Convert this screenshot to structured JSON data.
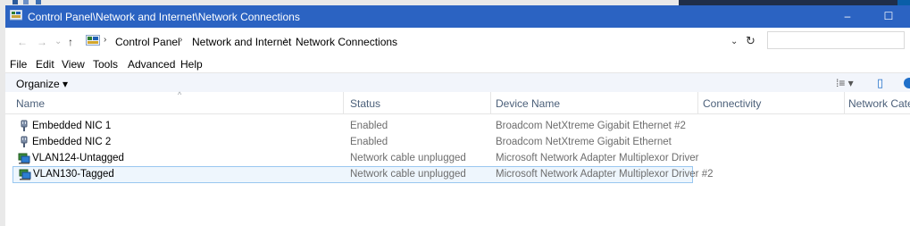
{
  "window": {
    "title": "Control Panel\\Network and Internet\\Network Connections",
    "minimize": "–",
    "maximize": "☐",
    "close": "✕"
  },
  "nav": {
    "back": "←",
    "forward": "→",
    "recent": "⌄",
    "up": "↑"
  },
  "address": {
    "crumbs": [
      "Control Panel",
      "Network and Internet",
      "Network Connections"
    ],
    "separator": "›",
    "dropdown": "⌄",
    "refresh": "↻",
    "search_placeholder": ""
  },
  "menubar": {
    "items": [
      "File",
      "Edit",
      "View",
      "Tools",
      "Advanced",
      "Help"
    ]
  },
  "command_bar": {
    "organize": "Organize ▾",
    "view_options": "⁞≡ ▾",
    "preview_pane": "▯"
  },
  "columns": [
    "Name",
    "Status",
    "Device Name",
    "Connectivity",
    "Network Catego"
  ],
  "sort_indicator": "^",
  "rows": [
    {
      "name": "Embedded NIC 1",
      "status": "Enabled",
      "device": "Broadcom NetXtreme Gigabit Ethernet #2",
      "icon": "ethernet-plug-icon",
      "selected": false
    },
    {
      "name": "Embedded NIC 2",
      "status": "Enabled",
      "device": "Broadcom NetXtreme Gigabit Ethernet",
      "icon": "ethernet-plug-icon",
      "selected": false
    },
    {
      "name": "VLAN124-Untagged",
      "status": "Network cable unplugged",
      "device": "Microsoft Network Adapter Multiplexor Driver",
      "icon": "network-adapter-icon",
      "selected": false
    },
    {
      "name": "VLAN130-Tagged",
      "status": "Network cable unplugged",
      "device": "Microsoft Network Adapter Multiplexor Driver #2",
      "icon": "network-adapter-icon",
      "selected": true
    }
  ],
  "colors": {
    "titlebar": "#2b63c2",
    "header_text": "#4c607a",
    "selection_border": "#99c7f0",
    "selection_fill": "#eef6fd"
  }
}
